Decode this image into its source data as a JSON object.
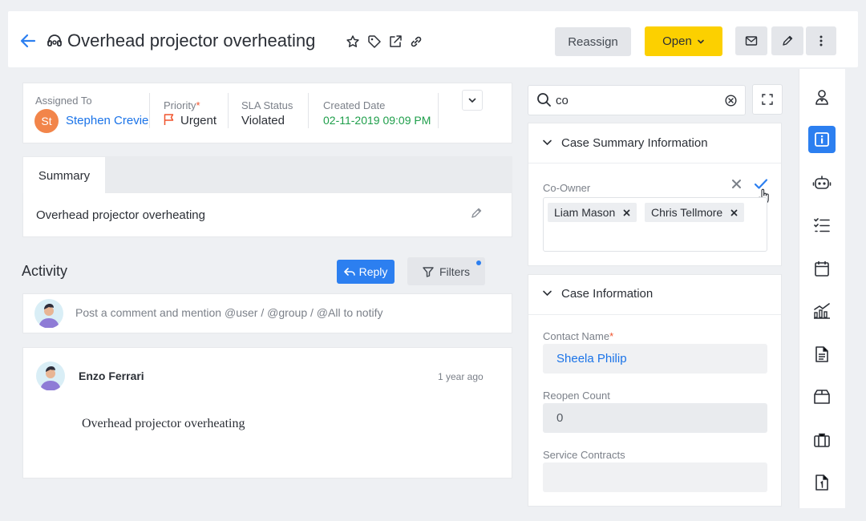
{
  "header": {
    "title": "Overhead projector overheating",
    "reassign_label": "Reassign",
    "status_label": "Open"
  },
  "meta": {
    "assigned_to_label": "Assigned To",
    "assignee_initials": "St",
    "assignee_name": "Stephen Crevier",
    "priority_label": "Priority",
    "priority_required": "*",
    "priority_value": "Urgent",
    "sla_label": "SLA Status",
    "sla_value": "Violated",
    "created_label": "Created Date",
    "created_value": "02-11-2019 09:09 PM"
  },
  "summary": {
    "tab_label": "Summary",
    "text": "Overhead projector overheating"
  },
  "activity": {
    "title": "Activity",
    "reply_label": "Reply",
    "filters_label": "Filters",
    "comment_placeholder": "Post a comment and mention @user / @group / @All to notify",
    "entries": [
      {
        "author": "Enzo Ferrari",
        "time": "1 year ago",
        "body": "Overhead projector overheating"
      }
    ]
  },
  "right_panel": {
    "search_value": "co",
    "case_summary": {
      "title": "Case Summary Information",
      "co_owner_label": "Co-Owner",
      "co_owners": [
        "Liam Mason",
        "Chris Tellmore"
      ]
    },
    "case_info": {
      "title": "Case Information",
      "contact_label": "Contact Name",
      "contact_required": "*",
      "contact_value": "Sheela Philip",
      "reopen_label": "Reopen Count",
      "reopen_value": "0",
      "service_label": "Service Contracts",
      "service_value": ""
    }
  },
  "colors": {
    "accent_blue": "#2c7ff0",
    "open_yellow": "#fcd000",
    "urgent_orange": "#f0542d",
    "created_green": "#1e9e4a"
  }
}
